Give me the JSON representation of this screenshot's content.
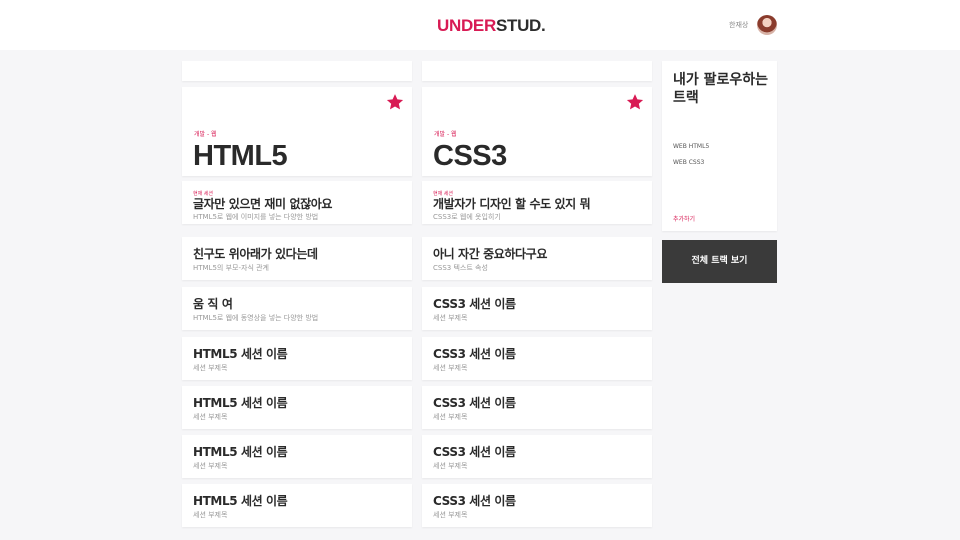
{
  "header": {
    "logo_primary": "UNDER",
    "logo_secondary": "STUD.",
    "username": "한재상"
  },
  "colors": {
    "accent": "#d81b54",
    "dark": "#3a3a3a"
  },
  "columns": [
    {
      "track": {
        "category": "개발 - 웹",
        "title": "HTML5",
        "starred": true
      },
      "sessions": [
        {
          "tag": "현재 세션",
          "title": "글자만 있으면 재미 없잖아요",
          "subtitle": "HTML5로 웹에 이미지를 넣는 다양한 방법"
        },
        {
          "title": "친구도 위아래가 있다는데",
          "subtitle": "HTML5의 부모-자식 관계"
        },
        {
          "title": "움 직 여",
          "subtitle": "HTML5로 웹에 동영상을 넣는 다양한 방법"
        },
        {
          "title": "HTML5 세션 이름",
          "subtitle": "세션 부제목"
        },
        {
          "title": "HTML5 세션 이름",
          "subtitle": "세션 부제목"
        },
        {
          "title": "HTML5 세션 이름",
          "subtitle": "세션 부제목"
        },
        {
          "title": "HTML5 세션 이름",
          "subtitle": "세션 부제목"
        }
      ]
    },
    {
      "track": {
        "category": "개발 - 웹",
        "title": "CSS3",
        "starred": true
      },
      "sessions": [
        {
          "tag": "현재 세션",
          "title": "개발자가 디자인 할 수도 있지 뭐",
          "subtitle": "CSS3로 웹에 옷입히기"
        },
        {
          "title": "아니 자간 중요하다구요",
          "subtitle": "CSS3 텍스트 속성"
        },
        {
          "title": "CSS3 세션 이름",
          "subtitle": "세션 부제목"
        },
        {
          "title": "CSS3 세션 이름",
          "subtitle": "세션 부제목"
        },
        {
          "title": "CSS3 세션 이름",
          "subtitle": "세션 부제목"
        },
        {
          "title": "CSS3 세션 이름",
          "subtitle": "세션 부제목"
        },
        {
          "title": "CSS3 세션 이름",
          "subtitle": "세션 부제목"
        }
      ]
    }
  ],
  "follow_panel": {
    "title": "내가 팔로우하는 트랙",
    "items": [
      "WEB HTML5",
      "WEB CSS3"
    ],
    "add_label": "추가하기"
  },
  "all_tracks_label": "전체 트랙 보기"
}
